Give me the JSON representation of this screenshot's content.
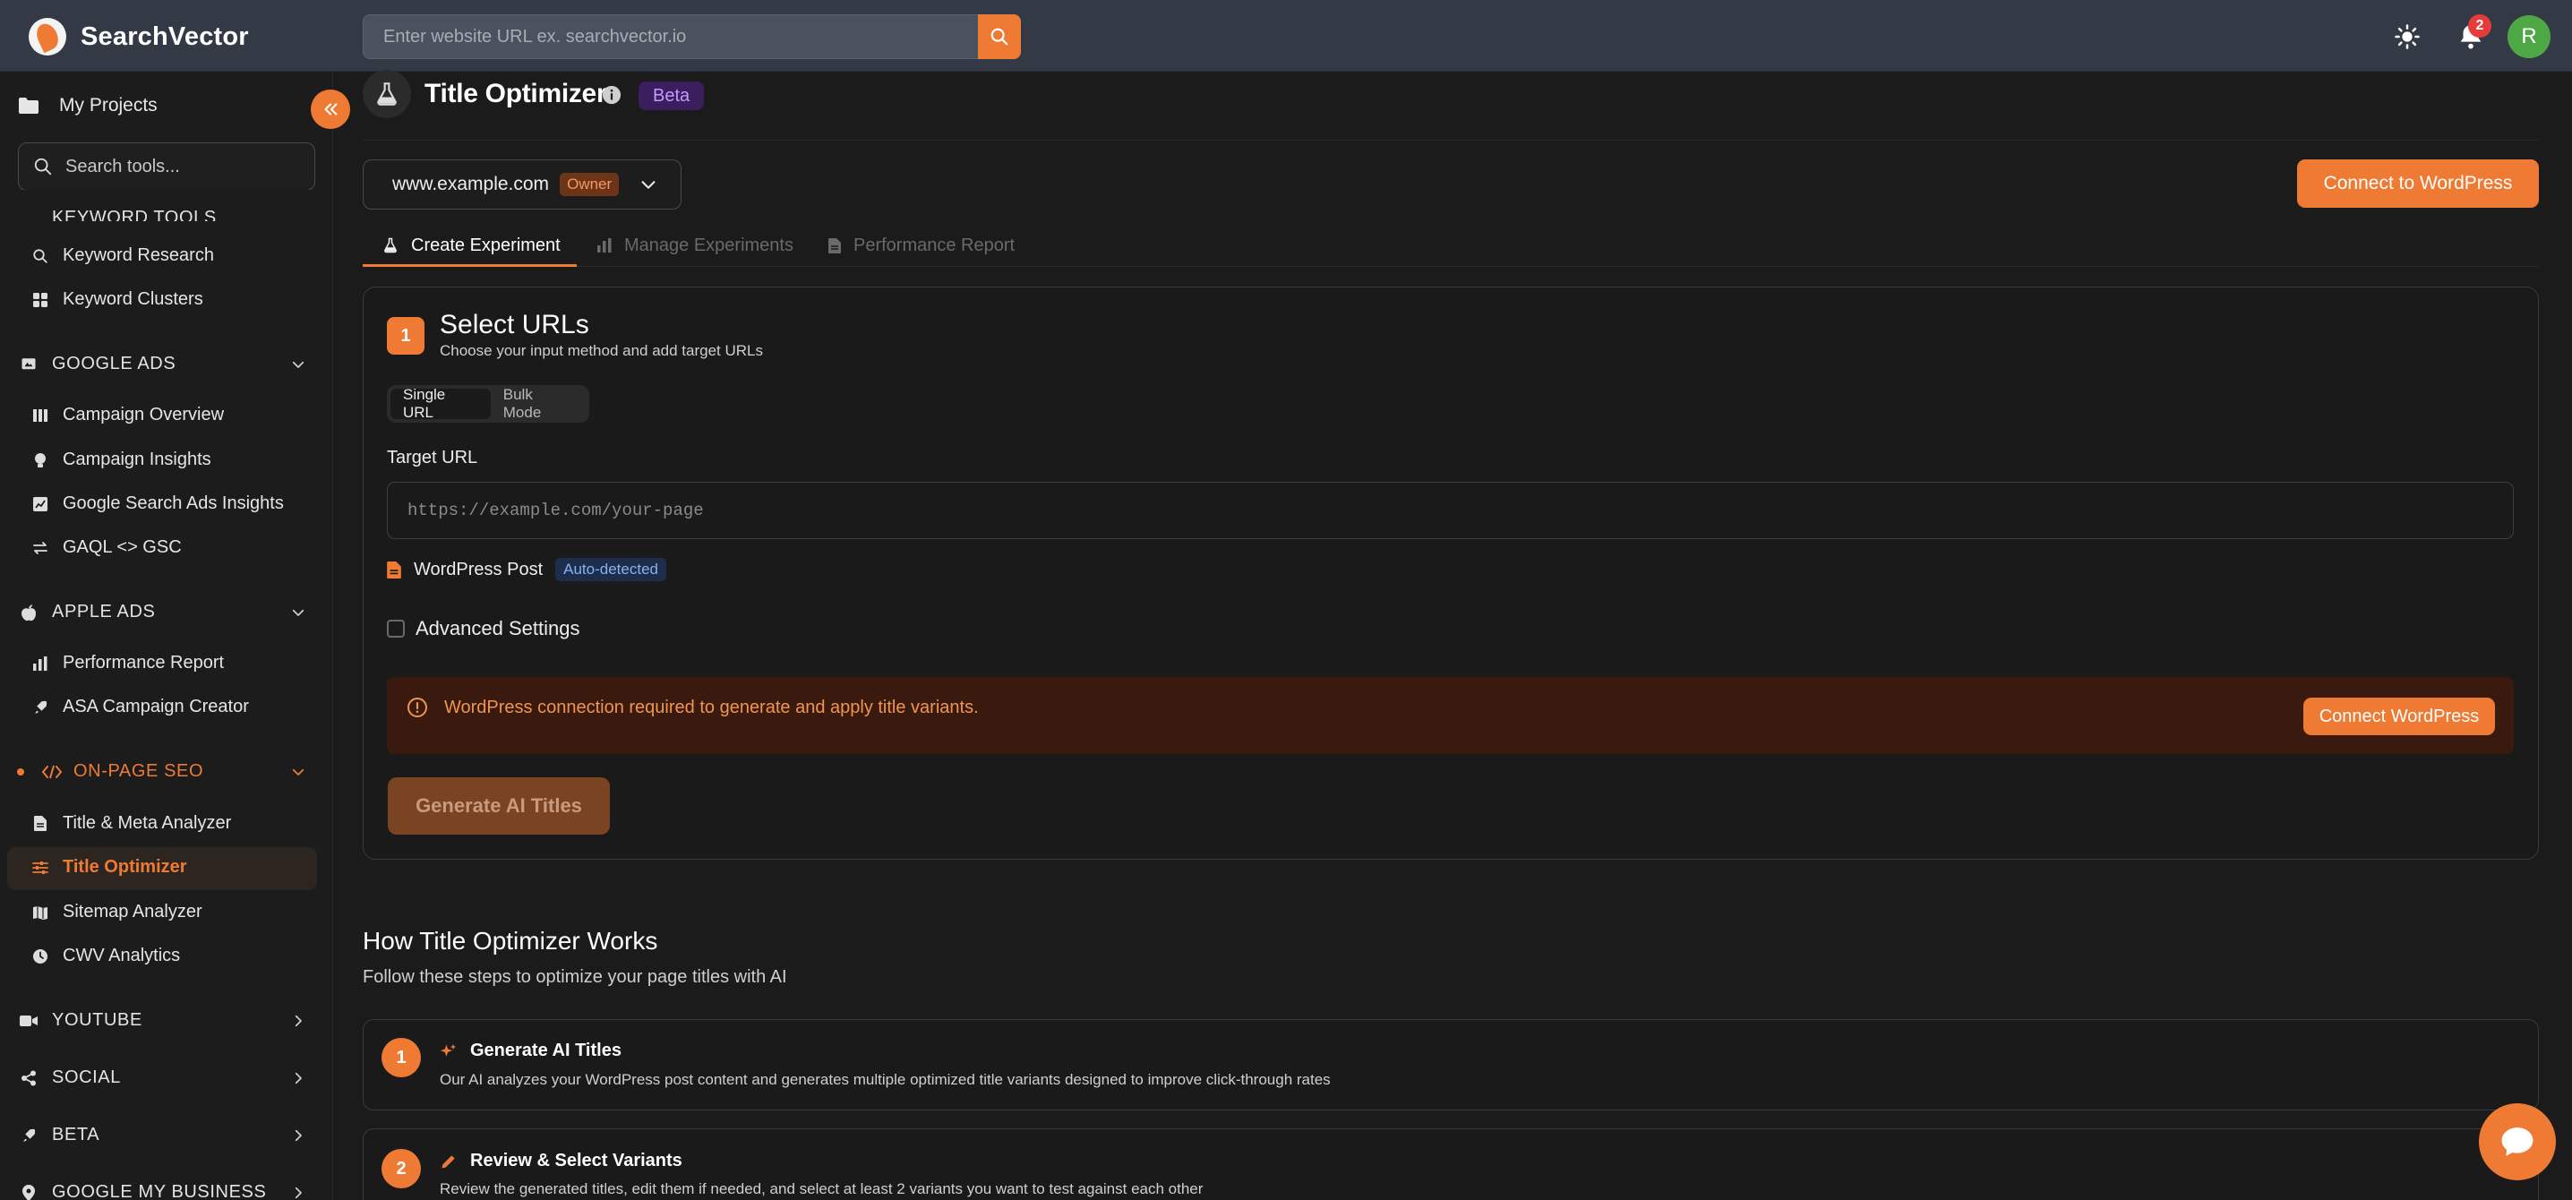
{
  "app": {
    "name": "SearchVector"
  },
  "topbar": {
    "search_placeholder": "Enter website URL ex. searchvector.io",
    "notifications_count": "2",
    "avatar_initial": "R"
  },
  "sidebar": {
    "my_projects": "My Projects",
    "search_placeholder": "Search tools...",
    "keyword_tools_header": "KEYWORD TOOLS",
    "keyword_items": [
      "Keyword Research",
      "Keyword Clusters"
    ],
    "google_ads_header": "GOOGLE ADS",
    "google_ads_items": [
      "Campaign Overview",
      "Campaign Insights",
      "Google Search Ads Insights",
      "GAQL <> GSC"
    ],
    "apple_ads_header": "APPLE ADS",
    "apple_ads_items": [
      "Performance Report",
      "ASA Campaign Creator"
    ],
    "onpage_header": "ON-PAGE SEO",
    "onpage_items": [
      "Title & Meta Analyzer",
      "Title Optimizer",
      "Sitemap Analyzer",
      "CWV Analytics"
    ],
    "youtube_header": "YOUTUBE",
    "social_header": "SOCIAL",
    "beta_header": "BETA",
    "gmb_header": "GOOGLE MY BUSINESS"
  },
  "page": {
    "title": "Title Optimizer",
    "badge": "Beta",
    "site": "www.example.com",
    "site_role": "Owner",
    "connect_button": "Connect to WordPress",
    "tabs": [
      "Create Experiment",
      "Manage Experiments",
      "Performance Report"
    ]
  },
  "step1": {
    "number": "1",
    "title": "Select URLs",
    "subtitle": "Choose your input method and add target URLs",
    "mode_single": "Single URL",
    "mode_bulk": "Bulk Mode",
    "target_label": "Target URL",
    "url_placeholder": "https://example.com/your-page",
    "wp_post_label": "WordPress Post",
    "auto_badge": "Auto-detected",
    "advanced_label": "Advanced Settings",
    "alert_text": "WordPress connection required to generate and apply title variants.",
    "alert_button": "Connect WordPress",
    "generate_button": "Generate AI Titles"
  },
  "how": {
    "title": "How Title Optimizer Works",
    "subtitle": "Follow these steps to optimize your page titles with AI",
    "steps": [
      {
        "num": "1",
        "title": "Generate AI Titles",
        "desc": "Our AI analyzes your WordPress post content and generates multiple optimized title variants designed to improve click-through rates"
      },
      {
        "num": "2",
        "title": "Review & Select Variants",
        "desc": "Review the generated titles, edit them if needed, and select at least 2 variants you want to test against each other"
      }
    ]
  }
}
